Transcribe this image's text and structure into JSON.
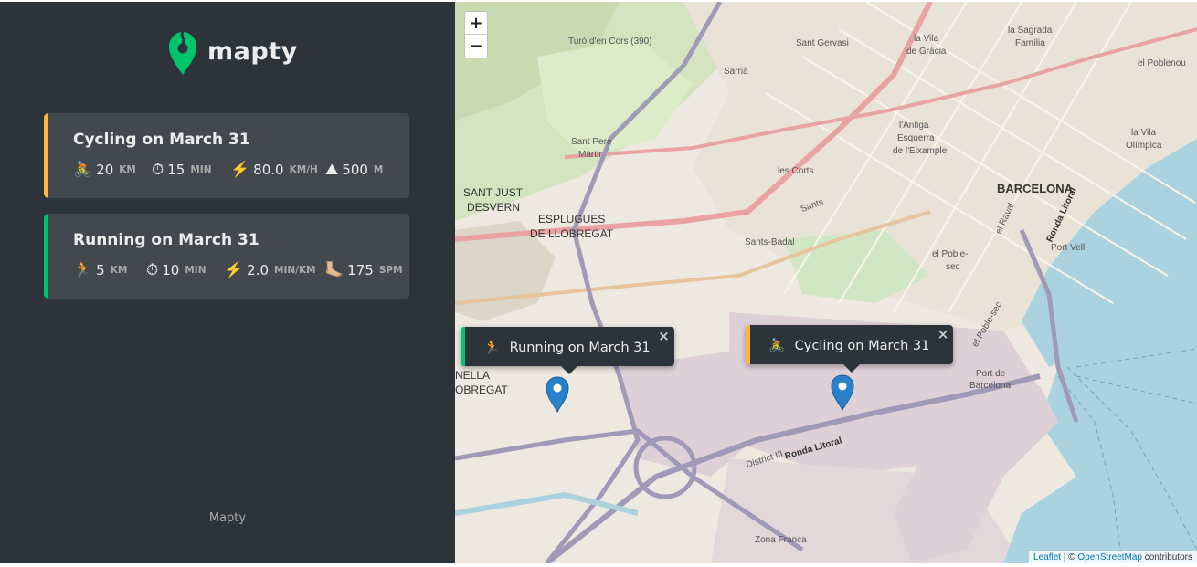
{
  "brand": {
    "name": "mapty",
    "logo_color": "#00c46a"
  },
  "workouts": [
    {
      "type": "cycling",
      "title": "Cycling on March 31",
      "accent": "#ffb545",
      "details": [
        {
          "icon": "🚴",
          "icon_name": "cyclist-icon",
          "value": "20",
          "unit": "km"
        },
        {
          "icon": "⏱",
          "icon_name": "stopwatch-icon",
          "value": "15",
          "unit": "min"
        },
        {
          "icon": "⚡️",
          "icon_name": "lightning-icon",
          "value": "80.0",
          "unit": "km/h"
        },
        {
          "icon": "⛰",
          "icon_name": "mountain-icon",
          "value": "500",
          "unit": "m"
        }
      ]
    },
    {
      "type": "running",
      "title": "Running on March 31",
      "accent": "#00c46a",
      "details": [
        {
          "icon": "🏃",
          "icon_name": "runner-icon",
          "value": "5",
          "unit": "km"
        },
        {
          "icon": "⏱",
          "icon_name": "stopwatch-icon",
          "value": "10",
          "unit": "min"
        },
        {
          "icon": "⚡️",
          "icon_name": "lightning-icon",
          "value": "2.0",
          "unit": "min/km"
        },
        {
          "icon": "🦶🏼",
          "icon_name": "foot-icon",
          "value": "175",
          "unit": "spm"
        }
      ]
    }
  ],
  "footer": {
    "text": "Mapty"
  },
  "map": {
    "zoom_in": "+",
    "zoom_out": "−",
    "popups": [
      {
        "type": "running",
        "icon": "🏃",
        "text": "Running on March 31",
        "close": "×"
      },
      {
        "type": "cycling",
        "icon": "🚴",
        "text": "Cycling on March 31",
        "close": "×"
      }
    ],
    "labels": {
      "barcelona": "BARCELONA",
      "sant_just": "SANT JUST",
      "desvern": "DESVERN",
      "esplugues": "ESPLUGUES",
      "de_llobregat": "DE LLOBREGAT",
      "sant_pere": "Sant Pere",
      "martir": "Màrtir",
      "sant_gervasi": "Sant Gervasi",
      "sarria": "Sarrià",
      "les_corts": "les Corts",
      "sants": "Sants",
      "sants_badal": "Sants-Badal",
      "la_vila": "la Vila",
      "de_gracia": "de Gràcia",
      "la_sagrada": "la Sagrada",
      "familia": "Família",
      "el_poblenou": "el Poblenou",
      "la_vila_olimpica1": "la Vila",
      "la_vila_olimpica2": "Olímpica",
      "antiga1": "l'Antiga",
      "antiga2": "Esquerra",
      "antiga3": "de l'Eixample",
      "el_poble_sec1": "el Poble-",
      "el_poble_sec2": "sec",
      "port_vell": "Port Vell",
      "port_de": "Port de",
      "port_barcelona": "Barcelona",
      "ronda_litoral": "Ronda Litoral",
      "district": "District III",
      "zona_franca": "Zona Franca",
      "turo": "Turó d'en Cors (390)",
      "nella": "NELLA",
      "obregat": "OBREGAT",
      "el_raval": "el Raval",
      "el_poble_sec_road": "el Poble-sec"
    },
    "attribution": {
      "leaflet": "Leaflet",
      "separator": " | © ",
      "osm": "OpenStreetMap",
      "contributors": " contributors"
    }
  }
}
